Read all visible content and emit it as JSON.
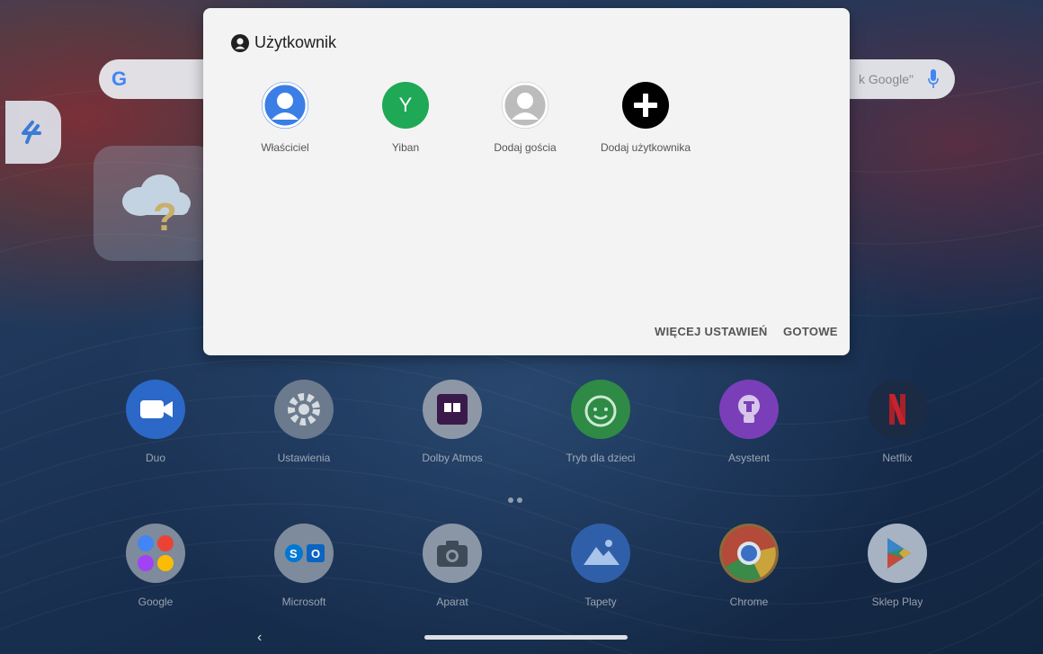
{
  "search": {
    "hint": "k Google\""
  },
  "dialog": {
    "title": "Użytkownik",
    "users": [
      {
        "label": "Właściciel"
      },
      {
        "label": "Yiban",
        "initial": "Y"
      },
      {
        "label": "Dodaj gościa"
      },
      {
        "label": "Dodaj użytkownika"
      }
    ],
    "more_settings": "WIĘCEJ USTAWIEŃ",
    "done": "GOTOWE"
  },
  "apps_row1": [
    {
      "label": "Duo"
    },
    {
      "label": "Ustawienia"
    },
    {
      "label": "Dolby Atmos"
    },
    {
      "label": "Tryb dla dzieci"
    },
    {
      "label": "Asystent"
    },
    {
      "label": "Netflix"
    }
  ],
  "apps_row2": [
    {
      "label": "Google"
    },
    {
      "label": "Microsoft"
    },
    {
      "label": "Aparat"
    },
    {
      "label": "Tapety"
    },
    {
      "label": "Chrome"
    },
    {
      "label": "Sklep Play"
    }
  ],
  "colors": {
    "yiban_avatar": "#1fa855",
    "owner_avatar": "#3b7ee6",
    "duo": "#1a73e8",
    "kids": "#34a853",
    "assistant": "#8e44d6",
    "netflix": "#e50914"
  },
  "icons": {
    "owner": "person-icon",
    "guest": "guest-person-icon",
    "add": "plus-icon",
    "back": "chevron-left-icon"
  }
}
